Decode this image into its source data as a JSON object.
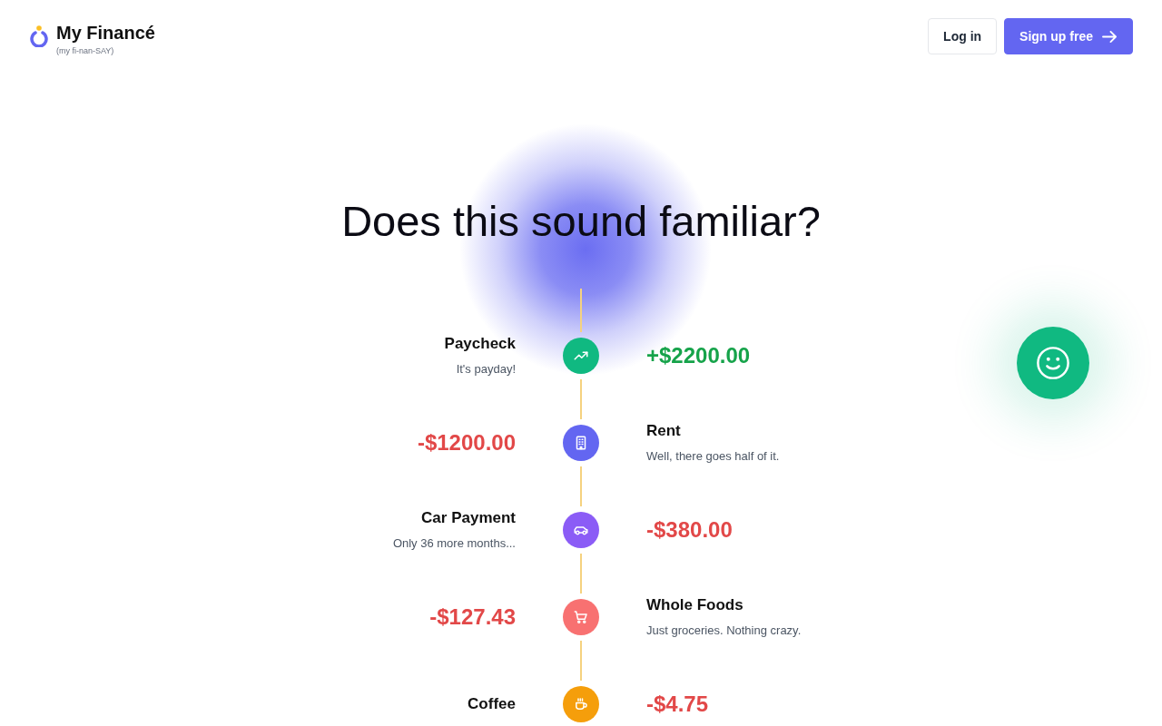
{
  "header": {
    "brand": {
      "name": "My Financé",
      "pronunciation": "(my fi-nan-SAY)"
    },
    "buttons": [
      {
        "label": "Log in",
        "kind": "secondary"
      },
      {
        "label": "Sign up free",
        "kind": "primary"
      }
    ]
  },
  "heading": "Does this sound familiar?",
  "timeline": [
    {
      "title": "Paycheck",
      "note": "It's payday!",
      "amount": "+$2200.00",
      "income": true,
      "kind": "income",
      "color": "#10b981"
    },
    {
      "title": "Rent",
      "note": "Well, there goes half of it.",
      "amount": "-$1200.00",
      "income": false,
      "kind": "housing",
      "color": "#6366f1"
    },
    {
      "title": "Car Payment",
      "note": "Only 36 more months...",
      "amount": "-$380.00",
      "income": false,
      "kind": "car",
      "color": "#8b5cf6"
    },
    {
      "title": "Whole Foods",
      "note": "Just groceries. Nothing crazy.",
      "amount": "-$127.43",
      "income": false,
      "kind": "groceries",
      "color": "#f87171"
    },
    {
      "title": "Coffee",
      "amount": "-$4.75",
      "income": false,
      "kind": "coffee",
      "color": "#f59e0b"
    }
  ]
}
